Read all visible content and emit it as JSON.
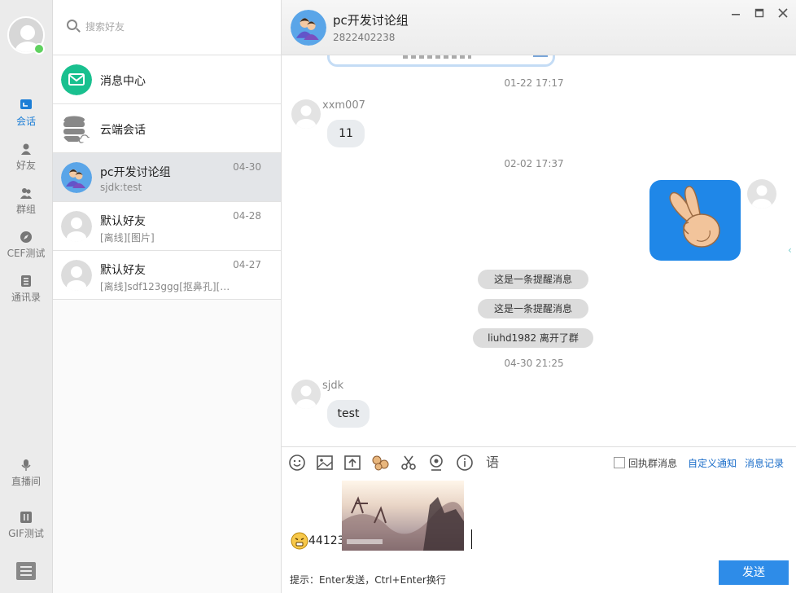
{
  "nav": {
    "items": [
      {
        "label": "会话",
        "icon": "chat-icon"
      },
      {
        "label": "好友",
        "icon": "friend-icon"
      },
      {
        "label": "群组",
        "icon": "group-icon"
      },
      {
        "label": "CEF测试",
        "icon": "compass-icon"
      },
      {
        "label": "通讯录",
        "icon": "contacts-icon"
      },
      {
        "label": "直播间",
        "icon": "microphone-icon"
      },
      {
        "label": "GIF测试",
        "icon": "gif-icon"
      }
    ],
    "status_color": "#5fd15f",
    "accent_color": "#1c7ed6"
  },
  "search": {
    "placeholder": "搜索好友"
  },
  "conversations": [
    {
      "name": "消息中心",
      "sub": "",
      "time": "",
      "icon": "mail-icon"
    },
    {
      "name": "云端会话",
      "sub": "",
      "time": "",
      "icon": "cloud-database-icon"
    },
    {
      "name": "pc开发讨论组",
      "sub": "sjdk:test",
      "time": "04-30",
      "icon": "group-avatar"
    },
    {
      "name": "默认好友",
      "sub": "[离线][图片]",
      "time": "04-28",
      "icon": "default-avatar"
    },
    {
      "name": "默认好友",
      "sub": "[离线]sdf123ggg[抠鼻孔][…",
      "time": "04-27",
      "icon": "default-avatar"
    }
  ],
  "chat": {
    "title": "pc开发讨论组",
    "id": "2822402238",
    "window_controls": [
      "minimize",
      "maximize",
      "close"
    ],
    "messages": {
      "stamp1": "01-22 17:17",
      "sender1": "xxm007",
      "text1": "11",
      "stamp2": "02-02 17:37",
      "notices": [
        "这是一条提醒消息",
        "这是一条提醒消息",
        "liuhd1982 离开了群"
      ],
      "stamp3": "04-30 21:25",
      "sender2": "sjdk",
      "text2": "test"
    },
    "toolbar": {
      "tools": [
        "emoji-icon",
        "image-icon",
        "upload-file-icon",
        "sticker-icon",
        "screenshot-scissors-icon",
        "webcam-icon",
        "info-icon",
        "voice-to-text-icon"
      ],
      "voice_label": "语",
      "checkbox_label": "回执群消息",
      "custom_notice": "自定义通知",
      "history": "消息记录"
    },
    "draft_text": "44123",
    "hint": "提示：Enter发送，Ctrl+Enter换行",
    "send_label": "发送",
    "send_color": "#2e8ce8"
  }
}
